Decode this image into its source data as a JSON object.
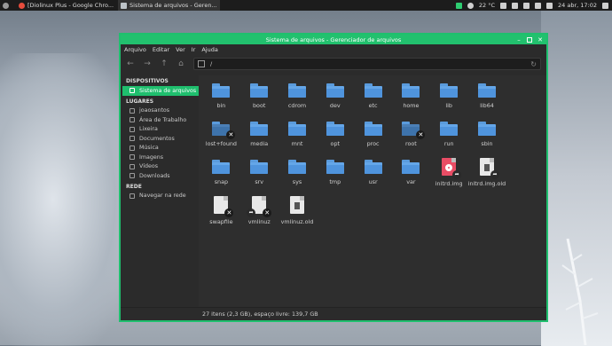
{
  "taskbar": {
    "tasks": [
      {
        "label": "[Diolinux Plus - Google Chro...",
        "color": "#e74c3c"
      },
      {
        "label": "Sistema de arquivos - Geren...",
        "color": "#bdc3c7"
      }
    ],
    "weather": "22 °C",
    "clock": "24 abr, 17:02"
  },
  "window": {
    "title": "Sistema de arquivos - Gerenciador de arquivos",
    "menu": [
      "Arquivo",
      "Editar",
      "Ver",
      "Ir",
      "Ajuda"
    ],
    "path": "/",
    "accent": "#22c16e"
  },
  "sidebar": {
    "sections": [
      {
        "heading": "DISPOSITIVOS",
        "items": [
          {
            "label": "Sistema de arquivos",
            "icon": "drive-icon",
            "selected": true
          }
        ]
      },
      {
        "heading": "LUGARES",
        "items": [
          {
            "label": "joaosantos",
            "icon": "home-icon"
          },
          {
            "label": "Área de Trabalho",
            "icon": "desktop-icon"
          },
          {
            "label": "Lixeira",
            "icon": "trash-icon"
          },
          {
            "label": "Documentos",
            "icon": "documents-icon"
          },
          {
            "label": "Música",
            "icon": "music-icon"
          },
          {
            "label": "Imagens",
            "icon": "pictures-icon"
          },
          {
            "label": "Vídeos",
            "icon": "videos-icon"
          },
          {
            "label": "Downloads",
            "icon": "downloads-icon"
          }
        ]
      },
      {
        "heading": "REDE",
        "items": [
          {
            "label": "Navegar na rede",
            "icon": "network-icon"
          }
        ]
      }
    ]
  },
  "files": [
    {
      "name": "bin",
      "kind": "folder"
    },
    {
      "name": "boot",
      "kind": "folder"
    },
    {
      "name": "cdrom",
      "kind": "folder"
    },
    {
      "name": "dev",
      "kind": "folder"
    },
    {
      "name": "etc",
      "kind": "folder"
    },
    {
      "name": "home",
      "kind": "folder"
    },
    {
      "name": "lib",
      "kind": "folder"
    },
    {
      "name": "lib64",
      "kind": "folder"
    },
    {
      "name": "lost+found",
      "kind": "folder-locked"
    },
    {
      "name": "media",
      "kind": "folder"
    },
    {
      "name": "mnt",
      "kind": "folder"
    },
    {
      "name": "opt",
      "kind": "folder"
    },
    {
      "name": "proc",
      "kind": "folder"
    },
    {
      "name": "root",
      "kind": "folder-locked"
    },
    {
      "name": "run",
      "kind": "folder"
    },
    {
      "name": "sbin",
      "kind": "folder"
    },
    {
      "name": "snap",
      "kind": "folder"
    },
    {
      "name": "srv",
      "kind": "folder"
    },
    {
      "name": "sys",
      "kind": "folder"
    },
    {
      "name": "tmp",
      "kind": "folder"
    },
    {
      "name": "usr",
      "kind": "folder"
    },
    {
      "name": "var",
      "kind": "folder"
    },
    {
      "name": "initrd.img",
      "kind": "image-link"
    },
    {
      "name": "initrd.img.old",
      "kind": "archive-link"
    },
    {
      "name": "swapfile",
      "kind": "file-locked"
    },
    {
      "name": "vmlinuz",
      "kind": "file-link-locked"
    },
    {
      "name": "vmlinuz.old",
      "kind": "archive"
    }
  ],
  "status": "27 itens (2,3 GB), espaço livre: 139,7 GB"
}
